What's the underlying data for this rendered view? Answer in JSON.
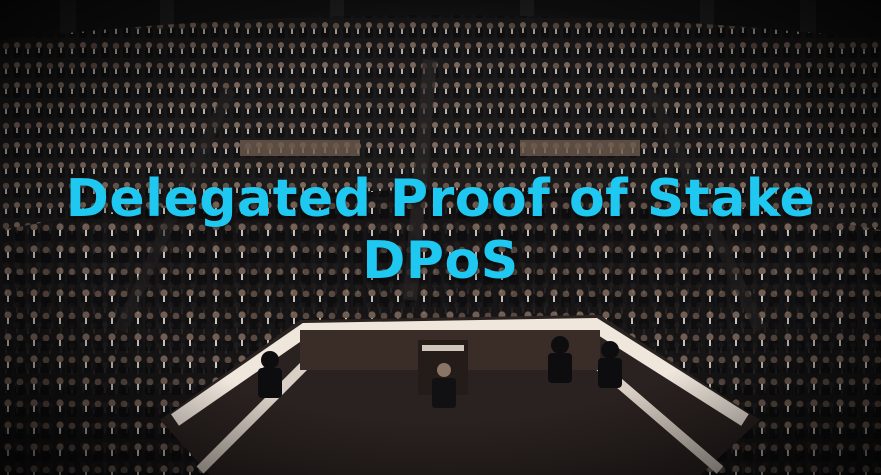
{
  "overlay": {
    "title_line_1": "Delegated Proof of Stake",
    "title_line_2": "DPoS",
    "text_color": "#1ec8f0"
  },
  "scene": {
    "subject": "assembly-chamber-with-podium"
  }
}
